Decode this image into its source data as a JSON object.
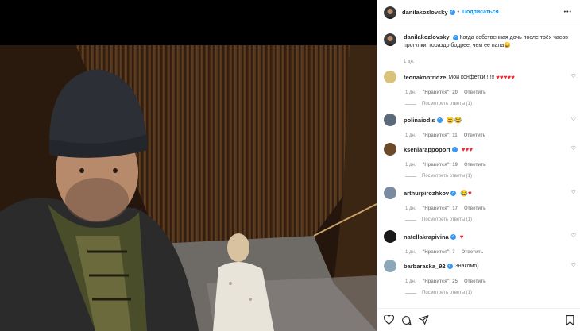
{
  "post": {
    "author": "danilakozlovsky",
    "follow_label": "Подписаться",
    "more_label": "•••",
    "caption_author": "danilakozlovsky",
    "caption_text": "Когда собственная дочь после трёх часов прогулки, гораздо бодрее, чем ее папа",
    "caption_emoji": "😄",
    "caption_time": "1 дн."
  },
  "comments": [
    {
      "user": "teonakontridze",
      "verified": false,
      "text": "Мои конфетки !!!!!",
      "icons": "♥♥♥♥♥",
      "time": "1 дн.",
      "likes": "\"Нравится\": 20",
      "reply": "Ответить",
      "answers": "Посмотреть ответы (1)",
      "av": "#d9c27a"
    },
    {
      "user": "polinaiodis",
      "verified": true,
      "text": "",
      "icons": "😄😂",
      "time": "1 дн.",
      "likes": "\"Нравится\": 11",
      "reply": "Ответить",
      "answers": "",
      "av": "#5a6a7a"
    },
    {
      "user": "kseniarappoport",
      "verified": true,
      "text": "",
      "icons": "♥♥♥",
      "time": "1 дн.",
      "likes": "\"Нравится\": 19",
      "reply": "Ответить",
      "answers": "Посмотреть ответы (1)",
      "av": "#6b4a2a"
    },
    {
      "user": "arthurpirozhkov",
      "verified": true,
      "text": "",
      "icons": "😂♥",
      "time": "1 дн.",
      "likes": "\"Нравится\": 17",
      "reply": "Ответить",
      "answers": "Посмотреть ответы (1)",
      "av": "#7a8aa0"
    },
    {
      "user": "natellakrapivina",
      "verified": true,
      "text": "",
      "icons": "♥",
      "time": "1 дн.",
      "likes": "\"Нравится\": 7",
      "reply": "Ответить",
      "answers": "",
      "av": "#1a1a1a"
    },
    {
      "user": "barbaraska_92",
      "verified": true,
      "text": "Знакомо)",
      "icons": "",
      "time": "1 дн.",
      "likes": "\"Нравится\": 25",
      "reply": "Ответить",
      "answers": "Посмотреть ответы (1)",
      "av": "#8aa8b8"
    }
  ],
  "colors": {
    "accent": "#0095f6",
    "heart": "#ed2b33",
    "verified": "#3897f0",
    "muted": "#8e8e8e"
  },
  "icons": [
    "heart-icon",
    "comment-icon",
    "share-icon",
    "bookmark-icon",
    "more-icon"
  ]
}
